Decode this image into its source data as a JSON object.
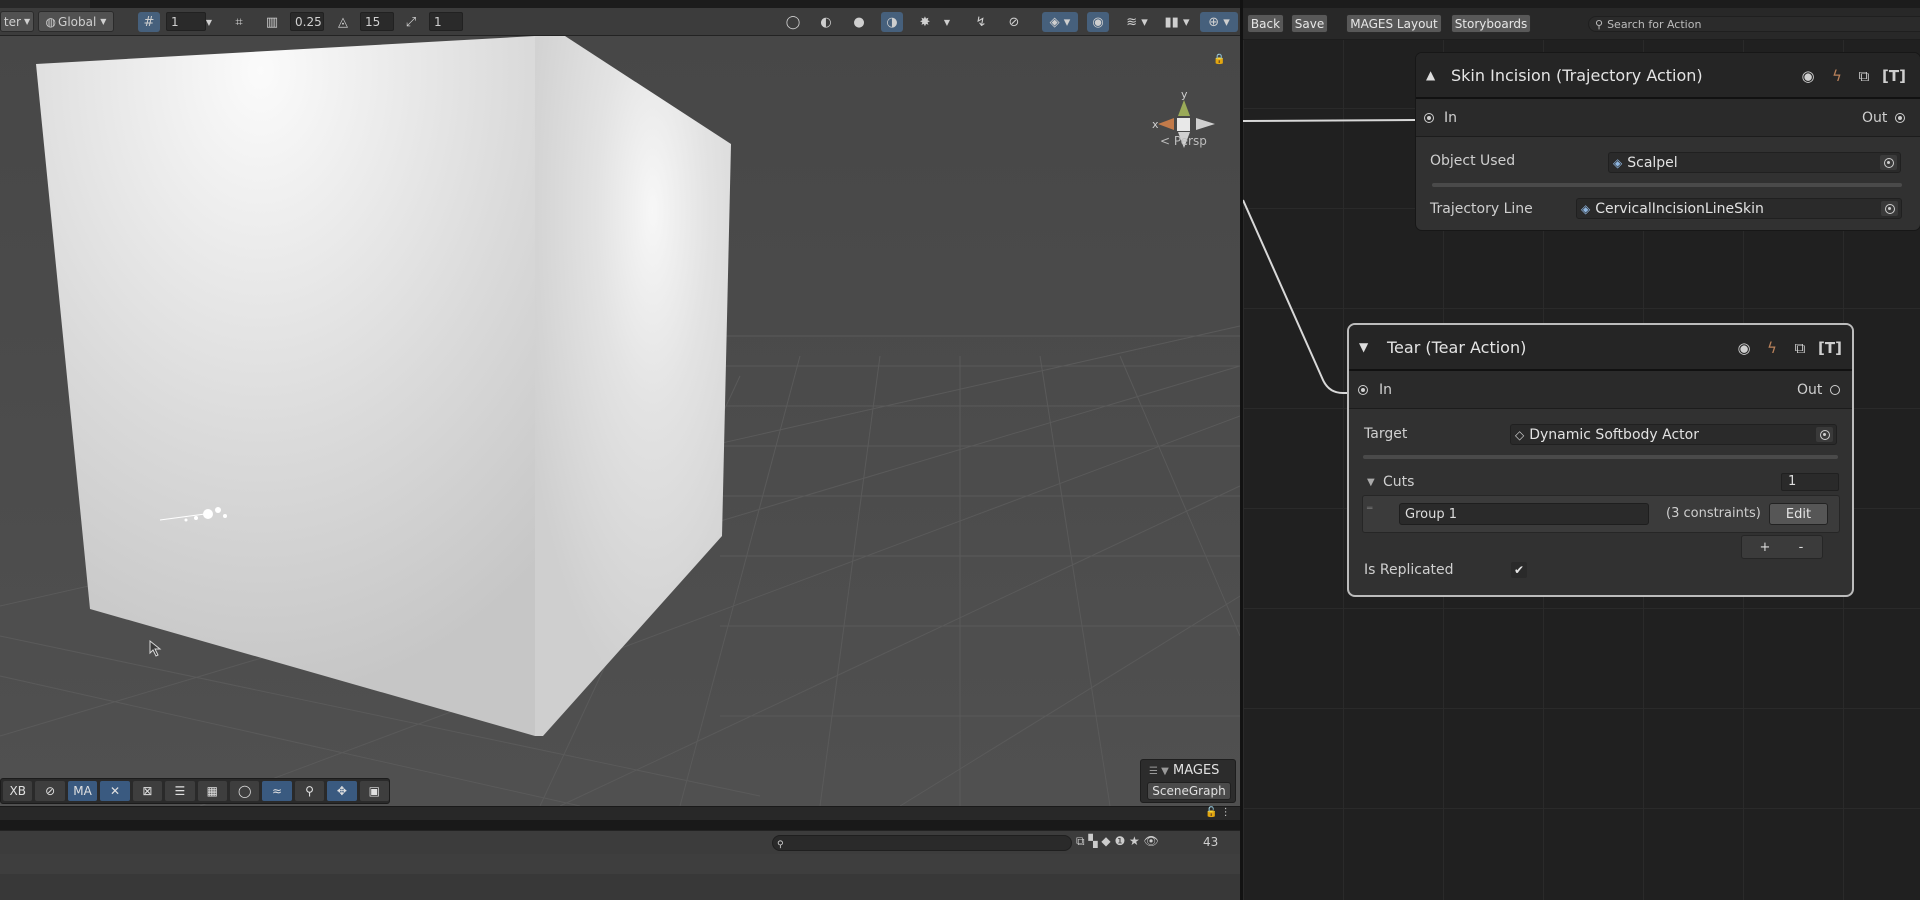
{
  "scene_toolbar": {
    "pivot_label": "ter",
    "space_label": "Global",
    "grid_value": "1",
    "snap_move": "0.25",
    "snap_rotate": "15",
    "snap_scale": "1"
  },
  "scene_view": {
    "projection_label": "< Persp",
    "gizmo_axes": {
      "x": "x",
      "y": "y"
    }
  },
  "tools_bar": {
    "items": [
      "XB",
      "",
      "MA",
      "",
      "",
      "",
      "",
      "",
      "",
      "",
      "",
      ""
    ]
  },
  "mages_overlay": {
    "title": "MAGES",
    "button": "SceneGraph"
  },
  "console": {
    "count": "43"
  },
  "graph_toolbar": {
    "back": "Back",
    "save": "Save",
    "layout": "MAGES Layout",
    "storyboards": "Storyboards",
    "search_placeholder": "Search for Action"
  },
  "node_skin": {
    "title": "Skin Incision (Trajectory Action)",
    "in_label": "In",
    "out_label": "Out",
    "props": [
      {
        "label": "Object Used",
        "value": "Scalpel"
      },
      {
        "label": "Trajectory Line",
        "value": "CervicalIncisionLineSkin"
      }
    ]
  },
  "node_tear": {
    "title": "Tear (Tear Action)",
    "in_label": "In",
    "out_label": "Out",
    "target_label": "Target",
    "target_value": "Dynamic Softbody Actor",
    "cuts_label": "Cuts",
    "cuts_count": "1",
    "group_name": "Group 1",
    "group_constraints": "(3 constraints)",
    "edit_label": "Edit",
    "add_label": "+",
    "remove_label": "-",
    "replicated_label": "Is Replicated",
    "replicated_check": "✔"
  }
}
